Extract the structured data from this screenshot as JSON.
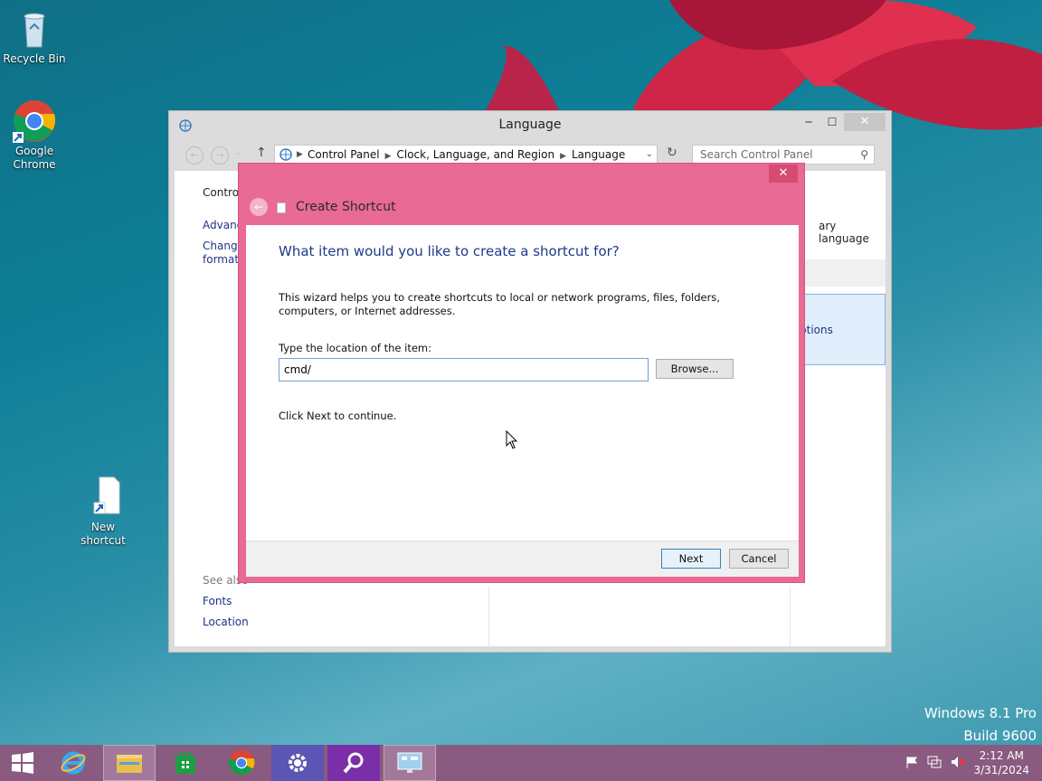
{
  "desktop": {
    "icons": [
      {
        "label": "Recycle Bin"
      },
      {
        "label": "Google Chrome"
      },
      {
        "label": "New shortcut"
      }
    ],
    "watermark": {
      "line1": "Windows 8.1 Pro",
      "line2": "Build 9600"
    }
  },
  "control_panel": {
    "title": "Language",
    "buttons": {
      "minimize": "─",
      "maximize": "☐",
      "close": "✕"
    },
    "breadcrumb": [
      "Control Panel",
      "Clock, Language, and Region",
      "Language"
    ],
    "search_placeholder": "Search Control Panel",
    "left_nav": {
      "home": "Control",
      "advanced": "Advanc",
      "change_formats_1": "Change",
      "change_formats_2": "formats",
      "see_also": "See also",
      "fonts": "Fonts",
      "location": "Location"
    },
    "right_fragments": {
      "primary_language": "ary language",
      "options": "ptions"
    }
  },
  "wizard": {
    "title": "Create Shortcut",
    "close": "✕",
    "heading": "What item would you like to create a shortcut for?",
    "description": "This wizard helps you to create shortcuts to local or network programs, files, folders, computers, or Internet addresses.",
    "location_label": "Type the location of the item:",
    "location_value": "cmd/",
    "browse_label": "Browse...",
    "hint": "Click Next to continue.",
    "next_label": "Next",
    "cancel_label": "Cancel",
    "accent_color": "#e86a95"
  },
  "taskbar": {
    "pinned": [
      "start-icon",
      "internet-explorer-icon",
      "file-explorer-icon",
      "store-icon",
      "chrome-icon",
      "settings-icon",
      "search-icon",
      "control-panel-icon"
    ],
    "clock_time": "2:12 AM",
    "clock_date": "3/31/2024",
    "color": "#8a5b80"
  }
}
